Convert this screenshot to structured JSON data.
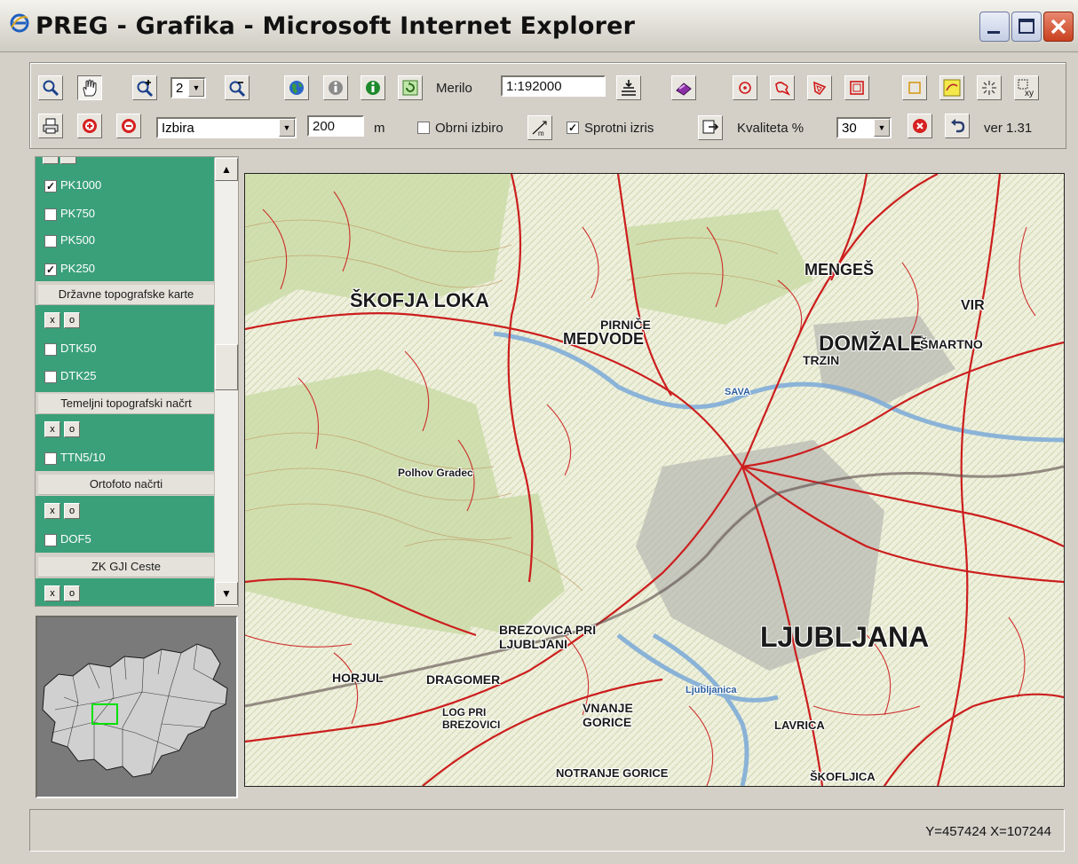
{
  "window": {
    "title": "PREG - Grafika - Microsoft Internet Explorer"
  },
  "toolbar": {
    "zoom_level": "2",
    "zoom_options": [
      "2"
    ],
    "merilo_label": "Merilo",
    "scale_value": "1:192000",
    "selection_value": "Izbira",
    "distance_value": "200",
    "distance_unit": "m",
    "obrni_izbiro_label": "Obrni izbiro",
    "obrni_izbiro_checked": false,
    "sprotni_izris_label": "Sprotni izris",
    "sprotni_izris_checked": true,
    "kvaliteta_label": "Kvaliteta %",
    "quality_value": "30",
    "version_label": "ver 1.31"
  },
  "layers": {
    "pk_items": [
      {
        "label": "PK1000",
        "checked": true
      },
      {
        "label": "PK750",
        "checked": false
      },
      {
        "label": "PK500",
        "checked": false
      },
      {
        "label": "PK250",
        "checked": true
      }
    ],
    "groups": [
      {
        "title": "Državne topografske karte",
        "items": [
          {
            "label": "DTK50",
            "checked": false
          },
          {
            "label": "DTK25",
            "checked": false
          }
        ]
      },
      {
        "title": "Temeljni topografski načrt",
        "items": [
          {
            "label": "TTN5/10",
            "checked": false
          }
        ]
      },
      {
        "title": "Ortofoto načrti",
        "items": [
          {
            "label": "DOF5",
            "checked": false
          }
        ]
      },
      {
        "title": "ZK GJI Ceste",
        "items": []
      }
    ],
    "group_buttons": {
      "x_label": "x",
      "o_label": "o"
    }
  },
  "map": {
    "labels": {
      "skofja_loka": "ŠKOFJA LOKA",
      "medvode": "MEDVODE",
      "menges": "MENGEŠ",
      "domzale": "DOMŽALE",
      "trzin": "TRZIN",
      "ljubljana": "LJUBLJANA",
      "brezovica": "BREZOVICA PRI LJUBLJANI",
      "vnanje_gorice": "VNANJE GORICE",
      "notranje_gorice": "NOTRANJE GORICE",
      "lavrica": "LAVRICA",
      "horjul": "HORJUL",
      "dragomer": "DRAGOMER",
      "log": "LOG PRI BREZOVICI",
      "skofljica": "ŠKOFLJICA",
      "pirnice": "PIRNIČE",
      "vir": "VIR",
      "smartno": "ŠMARTNO",
      "polhov_gradec": "Polhov Gradec",
      "sava": "SAVA",
      "ljubljanica": "Ljubljanica"
    }
  },
  "status": {
    "coordinates": "Y=457424  X=107244"
  },
  "colors": {
    "layer_panel_green": "#3aa07a",
    "map_road_red": "#cc1e1e",
    "overview_extent": "#00e000"
  }
}
